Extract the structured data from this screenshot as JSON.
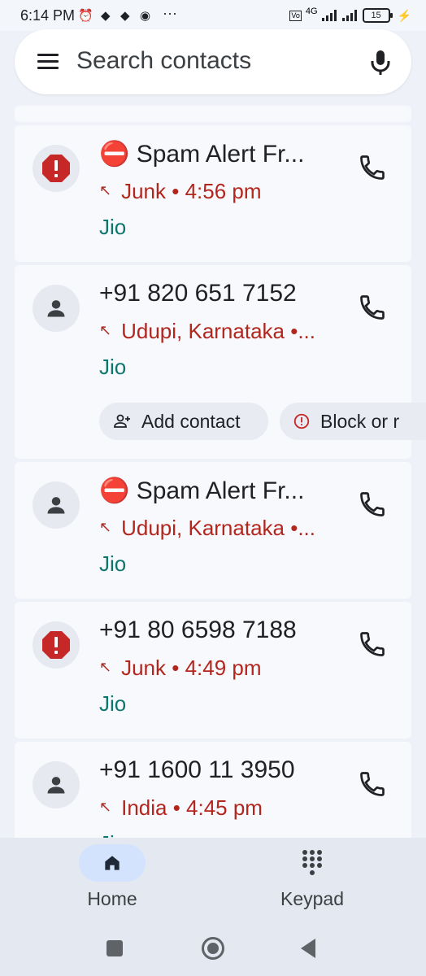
{
  "status_bar": {
    "time": "6:14 PM",
    "more": "···",
    "network": "4G",
    "battery": "15"
  },
  "search": {
    "placeholder": "Search contacts"
  },
  "calls": [
    {
      "avatar": "spam",
      "name": "⛔ Spam Alert Fr...",
      "detail": "Junk • 4:56 pm",
      "carrier": "Jio"
    },
    {
      "avatar": "person",
      "name": "+91 820 651 7152",
      "detail": "Udupi, Karnataka •...",
      "carrier": "Jio"
    },
    {
      "avatar": "person",
      "name": "⛔ Spam Alert Fr...",
      "detail": "Udupi, Karnataka •...",
      "carrier": "Jio"
    },
    {
      "avatar": "spam",
      "name": "+91 80 6598 7188",
      "detail": "Junk • 4:49 pm",
      "carrier": "Jio"
    },
    {
      "avatar": "person",
      "name": "+91 1600 11 3950",
      "detail": "India • 4:45 pm",
      "carrier": "Jio"
    }
  ],
  "actions": {
    "add_contact": "Add contact",
    "block": "Block or r"
  },
  "bottom_nav": {
    "home": "Home",
    "keypad": "Keypad",
    "active": "home"
  },
  "colors": {
    "accent_red": "#b3261e",
    "carrier_teal": "#0f766e",
    "spam_red": "#c62828",
    "nav_pill": "#d3e3fd"
  }
}
